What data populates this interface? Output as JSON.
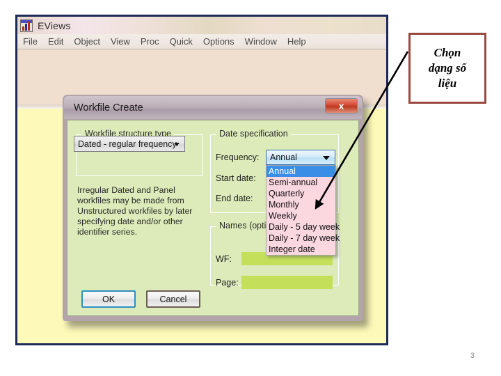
{
  "app": {
    "title": "EViews",
    "icon": "eviews-app-icon",
    "menu": [
      "File",
      "Edit",
      "Object",
      "View",
      "Proc",
      "Quick",
      "Options",
      "Window",
      "Help"
    ]
  },
  "dialog": {
    "title": "Workfile Create",
    "close_label": "x",
    "structure_group": {
      "legend": "Workfile structure type",
      "combo_value": "Dated - regular frequency",
      "note": "Irregular Dated and Panel workfiles may be made from Unstructured workfiles by later specifying date and/or other identifier series."
    },
    "date_group": {
      "legend": "Date specification",
      "frequency_label": "Frequency:",
      "frequency_value": "Annual",
      "start_date_label": "Start date:",
      "start_date_value": "",
      "end_date_label": "End date:",
      "end_date_value": "",
      "dropdown_open": true,
      "dropdown_options": [
        "Annual",
        "Semi-annual",
        "Quarterly",
        "Monthly",
        "Weekly",
        "Daily - 5 day week",
        "Daily - 7 day week",
        "Integer date"
      ],
      "dropdown_selected": "Annual"
    },
    "names_group": {
      "legend": "Names (optional)",
      "wf_label": "WF:",
      "wf_value": "",
      "page_label": "Page:",
      "page_value": ""
    },
    "ok_label": "OK",
    "cancel_label": "Cancel"
  },
  "annotation": {
    "line1": "Chọn",
    "line2": "dạng số",
    "line3": "liệu",
    "border_color": "#9b4840",
    "arrow_color": "#000000"
  },
  "slide": {
    "page_number": "3"
  },
  "colors": {
    "window_border": "#1b2a57",
    "workspace": "#fdf9b8",
    "dialog_body": "#dcebb9",
    "dropdown_bg": "#fbd7e0",
    "highlight": "#3a8ee6",
    "input_bg": "#c4e05b",
    "close_button": "#bd3a22"
  }
}
